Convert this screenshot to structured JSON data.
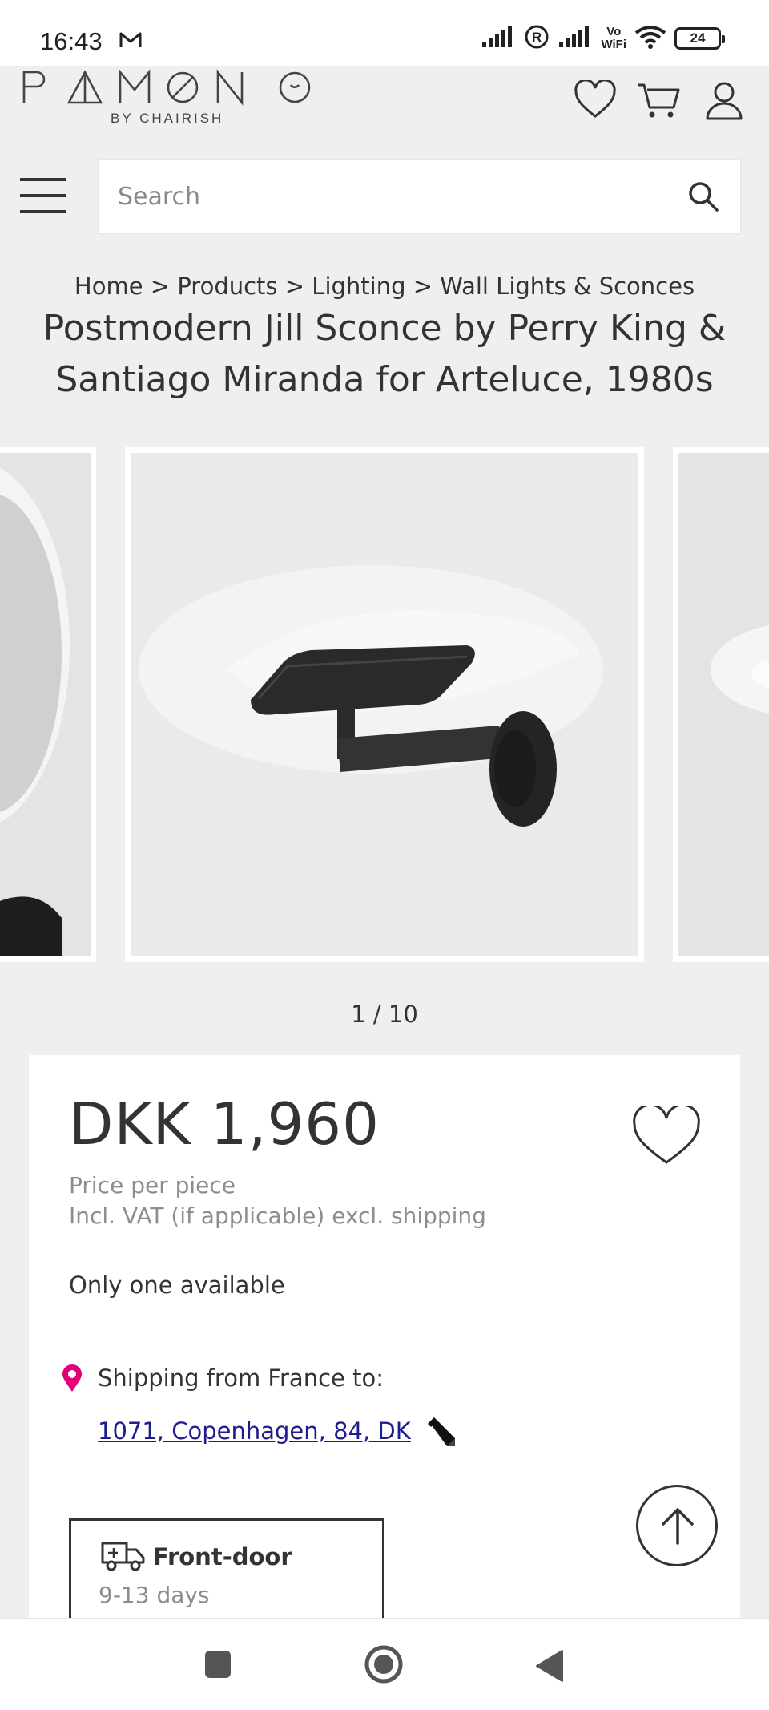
{
  "status_bar": {
    "time": "16:43",
    "vowifi_top": "Vo",
    "vowifi_bottom": "WiFi",
    "battery": "24"
  },
  "header": {
    "logo": "PAMONO",
    "logo_sub": "BY CHAIRISH"
  },
  "search": {
    "placeholder": "Search",
    "value": ""
  },
  "breadcrumb": {
    "items": [
      "Home",
      "Products",
      "Lighting",
      "Wall Lights & Sconces"
    ],
    "separator": ">"
  },
  "product": {
    "title": "Postmodern Jill Sconce by Perry King & Santiago Miranda for Arteluce, 1980s",
    "image_counter": "1 / 10",
    "price": "DKK 1,960",
    "price_note_1": "Price per piece",
    "price_note_2": "Incl. VAT (if applicable) excl. shipping",
    "availability": "Only one available",
    "shipping_from": "Shipping from France to:",
    "address": "1071, Copenhagen, 84, DK",
    "delivery": {
      "title": "Front-door",
      "days": "9-13 days"
    }
  },
  "colors": {
    "background": "#efefef",
    "text": "#333333",
    "muted": "#8d8d8d",
    "pin": "#e0007a",
    "link": "#1d1d8f"
  },
  "icons": [
    "mail-icon",
    "signal-icon",
    "registered-icon",
    "wifi-icon",
    "heart-icon",
    "cart-icon",
    "user-icon",
    "menu-icon",
    "search-icon",
    "location-pin-icon",
    "pencil-icon",
    "truck-icon",
    "arrow-up-icon"
  ]
}
